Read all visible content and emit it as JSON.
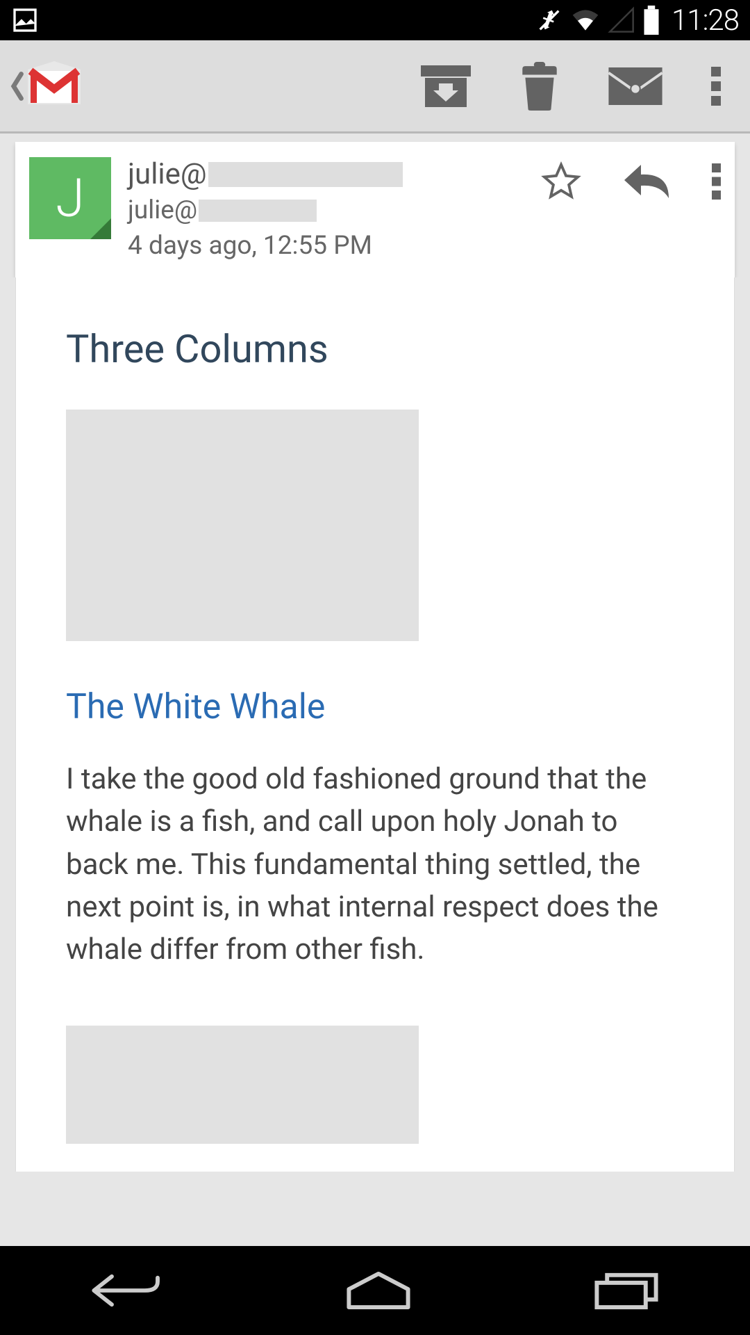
{
  "status": {
    "time": "11:28"
  },
  "sender": {
    "initial": "J",
    "from_prefix": "julie@",
    "to_prefix": "julie@"
  },
  "meta": {
    "timestamp": "4 days ago, 12:55 PM"
  },
  "content": {
    "heading": "Three Columns",
    "subheading": "The White Whale",
    "paragraph": "I take the good old fashioned ground that the whale is a fish, and call upon holy Jonah to back me. This fundamental thing settled, the next point is, in what internal respect does the whale differ from other fish."
  }
}
